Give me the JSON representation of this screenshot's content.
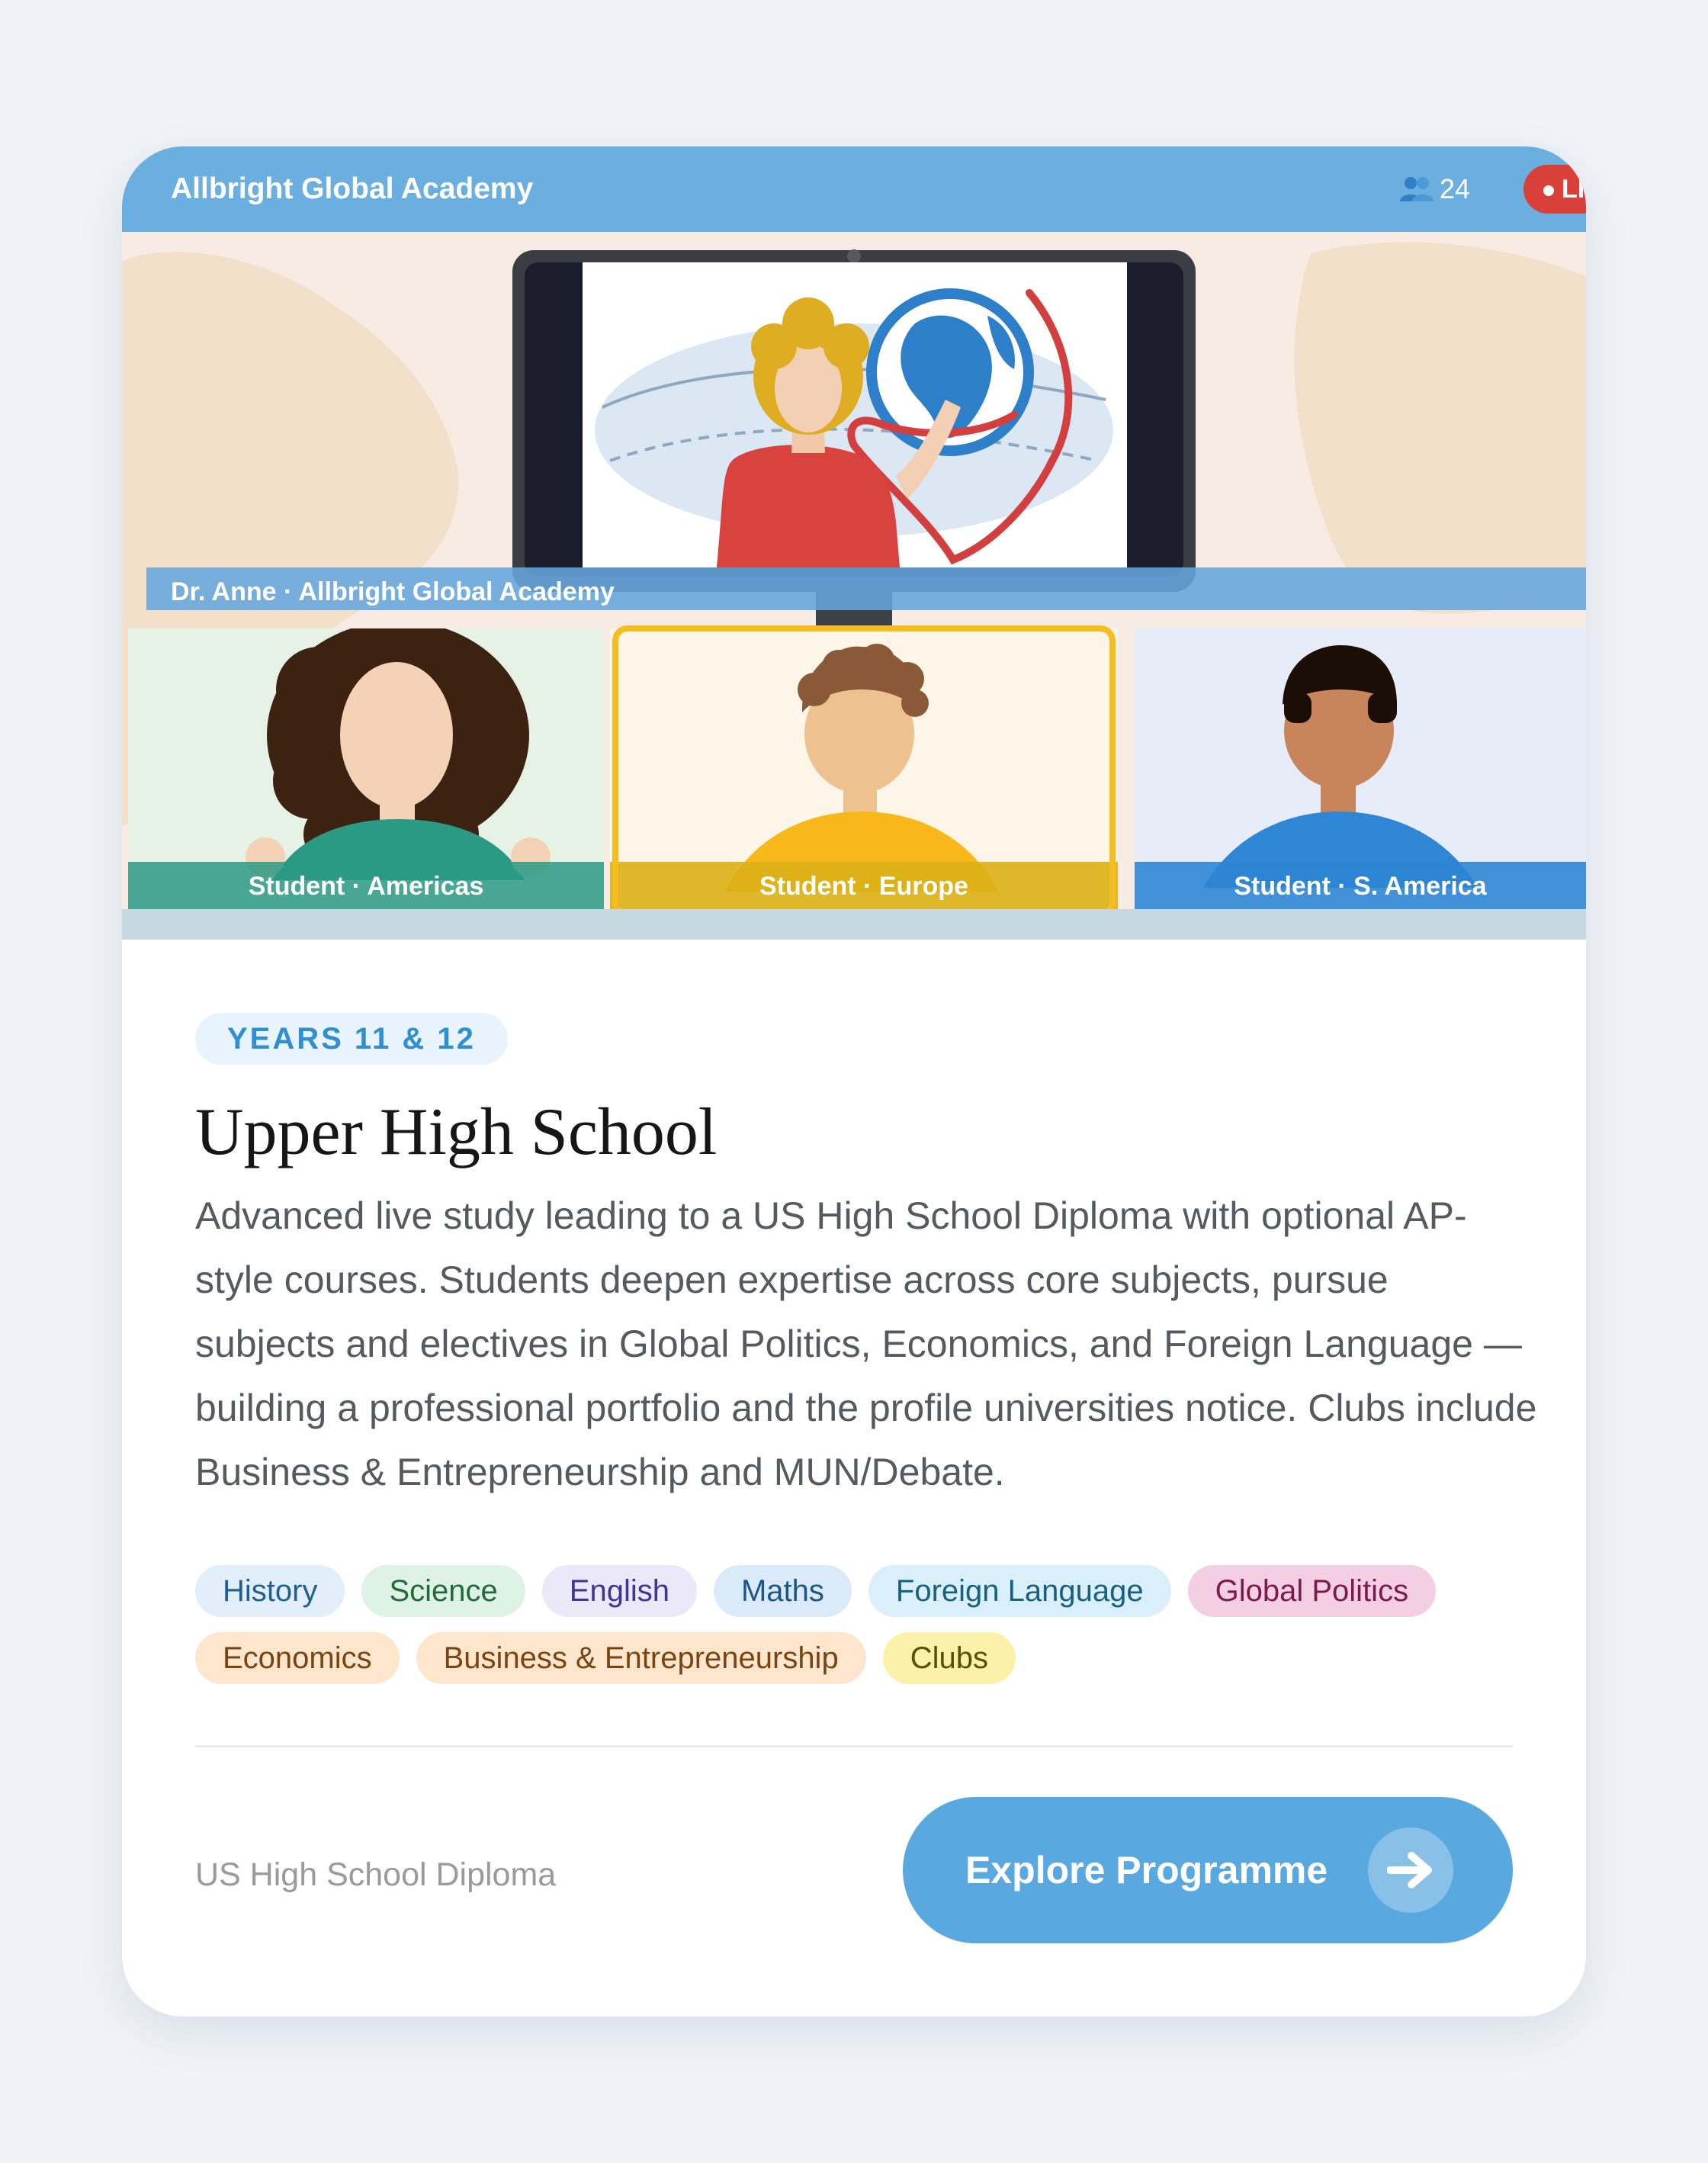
{
  "header": {
    "brand": "Allbright Global Academy",
    "viewer_count": "24",
    "live_label": "LIVE"
  },
  "video": {
    "teacher_caption": "Dr. Anne · Allbright Global Academy",
    "students": [
      {
        "label": "Student · Americas"
      },
      {
        "label": "Student · Europe"
      },
      {
        "label": "Student · S. America"
      }
    ]
  },
  "course": {
    "badge": "YEARS 11 & 12",
    "title": "Upper High School",
    "description": "Advanced live study leading to a US High School Diploma with optional AP-style courses. Students deepen expertise across core subjects, pursue subjects and electives in Global Politics, Economics, and Foreign Language — building a professional portfolio and the profile universities notice. Clubs include Business & Entrepreneurship and MUN/Debate.",
    "tags": [
      {
        "label": "History",
        "bg": "#e2effb",
        "fg": "#1f5f93"
      },
      {
        "label": "Science",
        "bg": "#dff2e6",
        "fg": "#216b3a"
      },
      {
        "label": "English",
        "bg": "#ebe8fa",
        "fg": "#3f3596"
      },
      {
        "label": "Maths",
        "bg": "#dbeaf8",
        "fg": "#1d5589"
      },
      {
        "label": "Foreign Language",
        "bg": "#d9f0fa",
        "fg": "#17607f"
      },
      {
        "label": "Global Politics",
        "bg": "#f4cfe3",
        "fg": "#7d1a4c"
      },
      {
        "label": "Economics",
        "bg": "#fde6cc",
        "fg": "#7a4412"
      },
      {
        "label": "Business & Entrepreneurship",
        "bg": "#fde6cc",
        "fg": "#7a4412"
      },
      {
        "label": "Clubs",
        "bg": "#fcf1a9",
        "fg": "#5c4f07"
      }
    ]
  },
  "footer": {
    "diploma": "US High School Diploma",
    "cta_label": "Explore Programme"
  },
  "colors": {
    "accent": "#5aa8e0",
    "topbar": "#6aafe0",
    "live": "#d9403a",
    "active_frame": "#f6bd22"
  },
  "icons": {
    "viewers": "people-icon",
    "cta": "arrow-right-icon"
  }
}
